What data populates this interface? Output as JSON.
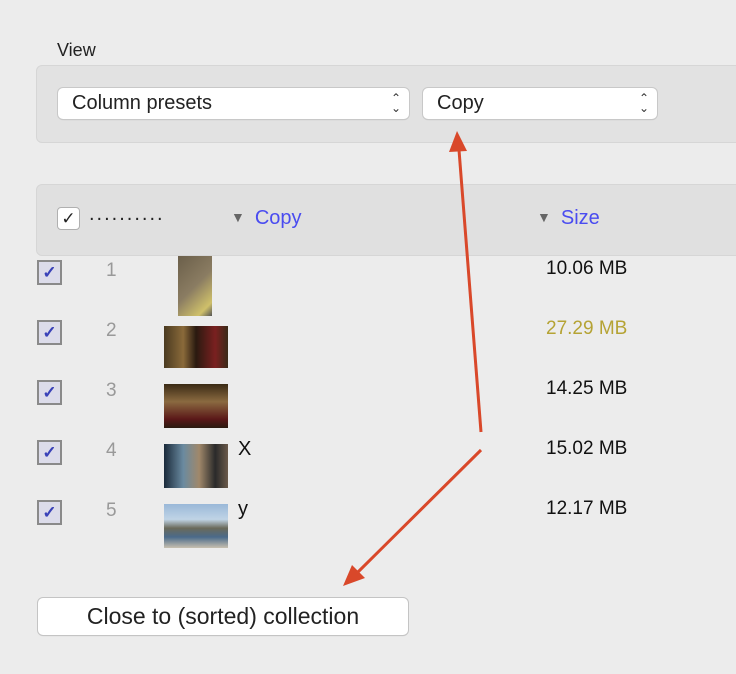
{
  "view": {
    "label": "View",
    "column_presets": "Column presets",
    "preset_value": "Copy"
  },
  "header": {
    "dots": "..........",
    "col_copy": "Copy",
    "col_size": "Size",
    "sort_icon": "triangle-down-icon"
  },
  "rows": [
    {
      "num": "1",
      "name": "",
      "size": "10.06 MB",
      "checked": true
    },
    {
      "num": "2",
      "name": "",
      "size": "27.29 MB",
      "checked": true,
      "highlight": "#b5a334"
    },
    {
      "num": "3",
      "name": "",
      "size": "14.25 MB",
      "checked": true
    },
    {
      "num": "4",
      "name": "X",
      "size": "15.02 MB",
      "checked": true
    },
    {
      "num": "5",
      "name": "y",
      "size": "12.17 MB",
      "checked": true
    }
  ],
  "close_button": "Close to (sorted) collection",
  "colors": {
    "accent": "#4a4cf0",
    "annotation_arrow": "#d9482a"
  }
}
